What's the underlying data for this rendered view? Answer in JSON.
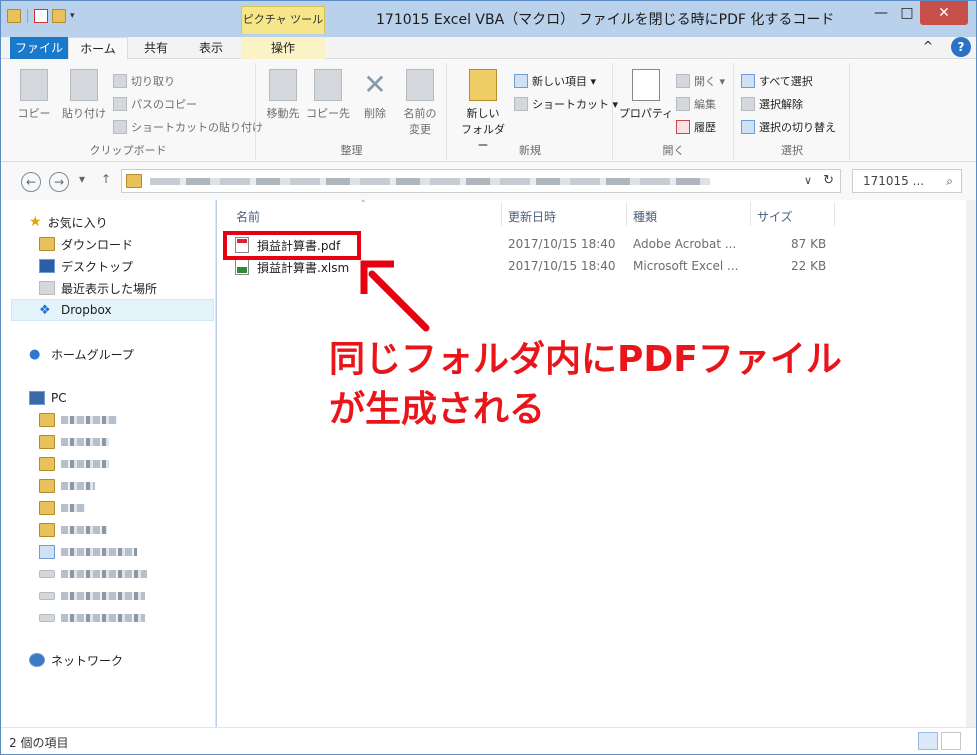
{
  "window": {
    "title": "171015 Excel VBA（マクロ） ファイルを閉じる時にPDF 化するコード",
    "context_tab_header": "ピクチャ ツール",
    "controls": {
      "minimize": "—",
      "maximize": "□",
      "close": "✕"
    }
  },
  "ribbon_tabs": {
    "file": "ファイル",
    "home": "ホーム",
    "share": "共有",
    "view": "表示",
    "operate": "操作",
    "expand": "^"
  },
  "ribbon": {
    "clipboard": {
      "label": "クリップボード",
      "copy": "コピー",
      "paste": "貼り付け",
      "cut": "切り取り",
      "copy_path": "パスのコピー",
      "paste_shortcut": "ショートカットの貼り付け"
    },
    "organize": {
      "label": "整理",
      "move_to": "移動先",
      "copy_to": "コピー先",
      "delete": "削除",
      "rename_line1": "名前の",
      "rename_line2": "変更"
    },
    "new": {
      "label": "新規",
      "new_folder_line1": "新しい",
      "new_folder_line2": "フォルダー",
      "new_item": "新しい項目 ▾",
      "shortcut": "ショートカット ▾"
    },
    "open": {
      "label": "開く",
      "properties": "プロパティ",
      "open": "開く ▾",
      "edit": "編集",
      "history": "履歴"
    },
    "select": {
      "label": "選択",
      "select_all": "すべて選択",
      "select_none": "選択解除",
      "invert": "選択の切り替え"
    }
  },
  "address": {
    "back": "←",
    "forward": "→",
    "recent": "▾",
    "up": "↑",
    "dropdown": "∨",
    "refresh": "↻",
    "search_value": "171015 ...",
    "search_icon": "⌕"
  },
  "nav": {
    "favorites": "お気に入り",
    "downloads": "ダウンロード",
    "desktop": "デスクトップ",
    "recent_places": "最近表示した場所",
    "dropbox": "Dropbox",
    "homegroup": "ホームグループ",
    "pc": "PC",
    "network": "ネットワーク"
  },
  "columns": {
    "name": "名前",
    "modified": "更新日時",
    "type": "種類",
    "size": "サイズ"
  },
  "files": [
    {
      "name": "損益計算書.pdf",
      "modified": "2017/10/15 18:40",
      "type": "Adobe Acrobat ...",
      "size": "87 KB"
    },
    {
      "name": "損益計算書.xlsm",
      "modified": "2017/10/15 18:40",
      "type": "Microsoft Excel ...",
      "size": "22 KB"
    }
  ],
  "annotation": {
    "text": "同じフォルダ内にPDFファイル\nが生成される",
    "color": "#e8151b"
  },
  "status": {
    "item_count": "2 個の項目"
  }
}
